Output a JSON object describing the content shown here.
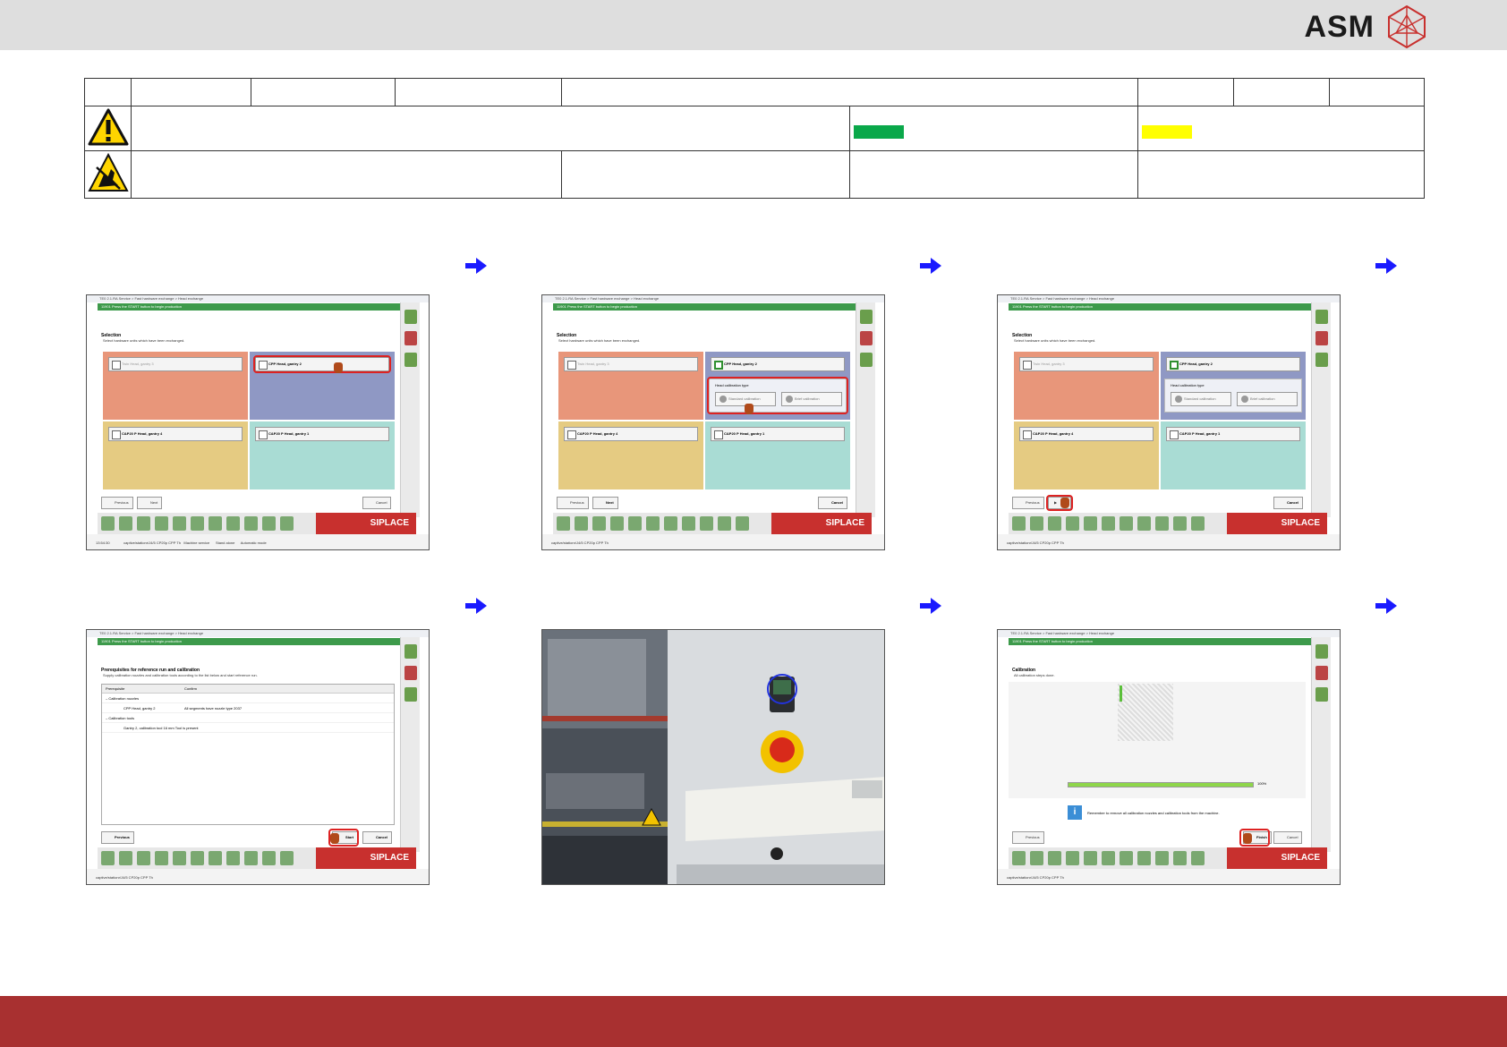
{
  "header": {
    "brand": "ASM",
    "logo_icon": "asm-logo-icon"
  },
  "table": {
    "warning_icon": "warning-triangle-icon",
    "esd_icon": "esd-hand-icon",
    "swatch_green": "#0aa84a",
    "swatch_yellow": "#ffff00"
  },
  "colors": {
    "footer": "#a83030",
    "arrow": "#1a1aff",
    "highlight": "#d22222"
  },
  "screenshots": {
    "window_title": "TE0 2.1.RA Service > Fast hardware exchange > Head exchange",
    "message": "11901 Press the START button to begin production",
    "selection_title": "Selection",
    "selection_sub": "Select hardware units which have been exchanged.",
    "twin_head": "Twin Head, gantry 3",
    "cpp_head": "CPP Head, gantry 2",
    "cp20_4": "C&P20 P Head, gantry 4",
    "cp20_1": "C&P20 P Head, gantry 1",
    "calib_type": "Head calibration type",
    "standard_cal": "Standard calibration",
    "brief_cal": "Brief calibration",
    "previous": "Previous",
    "next": "Next",
    "cancel": "Cancel",
    "start": "Start",
    "finish": "Finish",
    "brand": "SIPLACE",
    "status_time": "13:54:30",
    "status_station": "captive/stationr/J4/5 CP20p CPP Th",
    "status_mode1": "Machine service",
    "status_mode2": "Stand alone",
    "status_mode3": "Automatic mode",
    "prereq_title": "Prerequisites for reference run and calibration",
    "prereq_sub": "Supply calibration nozzles and calibration tools according to the list below and start reference run.",
    "col_prereq": "Prerequisite",
    "col_confirm": "Confirm",
    "row1": "Calibration nozzles",
    "row2": "CPP Head, gantry 2",
    "row2_confirm": "All segments have nozzle type 2037",
    "row3": "Calibration tools",
    "row4": "Gantry 2, calibration tool 16 mm",
    "row4_confirm": "Tool is present",
    "calib_title": "Calibration",
    "calib_sub": "All calibration steps done.",
    "progress_label": "100%",
    "progress": 1.0,
    "info_note": "Remember to remove all calibration nozzles and calibration tools from the machine."
  }
}
